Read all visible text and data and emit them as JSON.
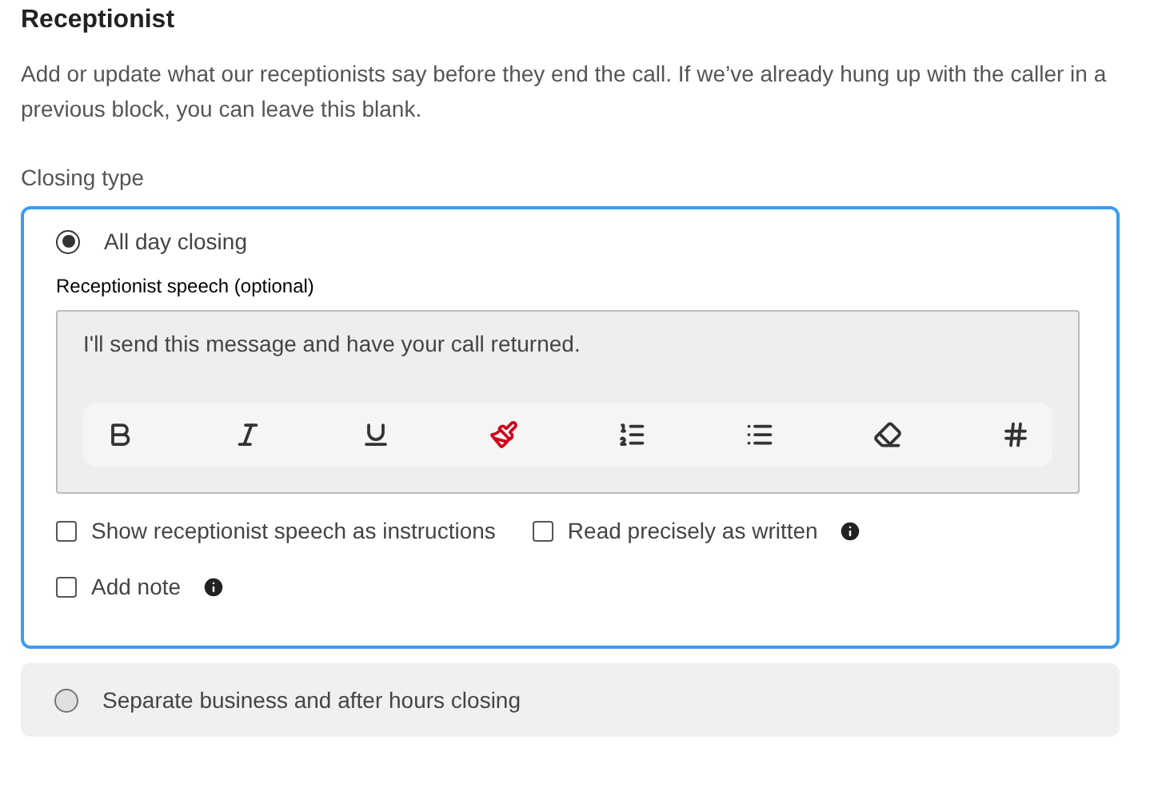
{
  "section": {
    "title": "Receptionist",
    "description": "Add or update what our receptionists say before they end the call. If we’ve already hung up with the caller in a previous block, you can leave this blank.",
    "field_label": "Closing type"
  },
  "options": [
    {
      "label": "All day closing",
      "selected": true,
      "speech": {
        "label": "Receptionist speech (optional)",
        "value": "I'll send this message and have your call returned."
      },
      "checkbox_rows": [
        [
          {
            "label": "Show receptionist speech as instructions",
            "checked": false,
            "info": false
          },
          {
            "label": "Read precisely as written",
            "checked": false,
            "info": true
          }
        ],
        [
          {
            "label": "Add note",
            "checked": false,
            "info": true
          }
        ]
      ]
    },
    {
      "label": "Separate business and after hours closing",
      "selected": false
    }
  ]
}
